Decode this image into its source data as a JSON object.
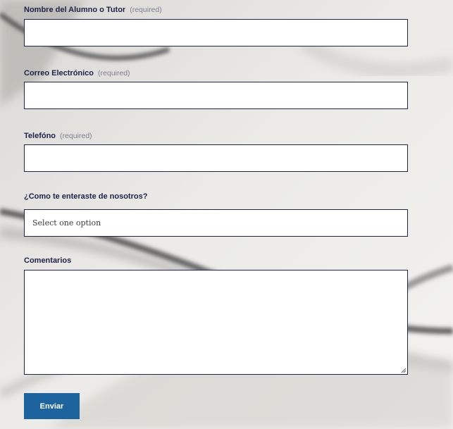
{
  "form": {
    "fields": [
      {
        "label": "Nombre del Alumno o Tutor",
        "required_text": "(required)",
        "value": ""
      },
      {
        "label": "Correo Electrónico",
        "required_text": "(required)",
        "value": ""
      },
      {
        "label": "Telefóno",
        "required_text": "(required)",
        "value": ""
      }
    ],
    "source": {
      "label": "¿Como te enteraste de nosotros?",
      "selected": "Select one option"
    },
    "comments": {
      "label": "Comentarios",
      "value": ""
    },
    "submit_label": "Enviar"
  },
  "colors": {
    "label": "#20234a",
    "field_border": "#1f2448",
    "button_bg": "#1d649f",
    "button_text": "#ffffff",
    "required_text": "#7d8090"
  },
  "icons": {
    "textarea_resize": "resize-grip-icon"
  }
}
